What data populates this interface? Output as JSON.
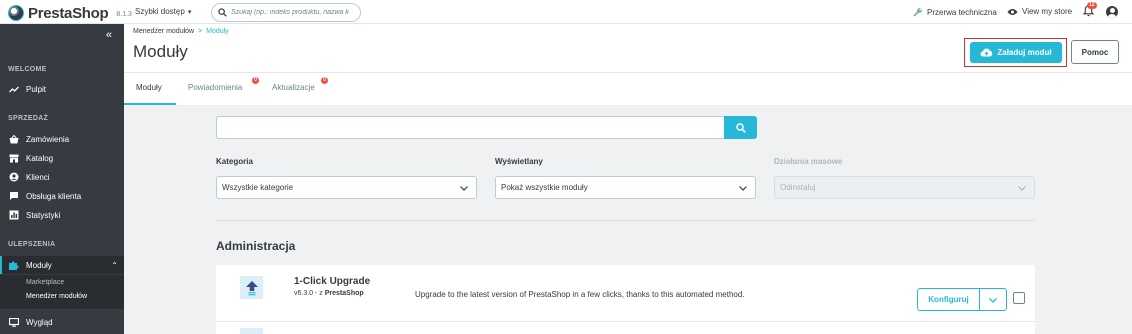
{
  "header": {
    "brand": "PrestaShop",
    "version": "8.1.3",
    "quick_access": "Szybki dostęp",
    "search_placeholder": "Szukaj (np.: indeks produktu, nazwa k",
    "maintenance": "Przerwa techniczna",
    "view_store": "View my store",
    "notifications_count": "12"
  },
  "sidebar": {
    "sections": {
      "welcome": "WELCOME",
      "sell": "SPRZEDAŻ",
      "improve": "ULEPSZENIA"
    },
    "items": [
      {
        "label": "Pulpit",
        "icon": "trending-up-icon"
      },
      {
        "label": "Zamówienia",
        "icon": "basket-icon"
      },
      {
        "label": "Katalog",
        "icon": "store-icon"
      },
      {
        "label": "Klienci",
        "icon": "account-circle-icon"
      },
      {
        "label": "Obsługa klienta",
        "icon": "chat-icon"
      },
      {
        "label": "Statystyki",
        "icon": "bar-chart-icon"
      },
      {
        "label": "Moduły",
        "icon": "puzzle-icon"
      },
      {
        "label": "Wygląd",
        "icon": "desktop-icon"
      }
    ],
    "sub_items": [
      "Marketplace",
      "Menedżer modułów"
    ]
  },
  "page": {
    "breadcrumb_parent": "Menedżer modułów",
    "breadcrumb_current": "Moduły",
    "title": "Moduły",
    "upload_button": "Załaduj moduł",
    "help_button": "Pomoc"
  },
  "tabs": [
    {
      "label": "Moduły",
      "badge": ""
    },
    {
      "label": "Powiadomienia",
      "badge": "0"
    },
    {
      "label": "Aktualizacje",
      "badge": "0"
    }
  ],
  "filters": {
    "category_label": "Kategoria",
    "category_value": "Wszystkie kategorie",
    "display_label": "Wyświetlany",
    "display_value": "Pokaż wszystkie moduły",
    "bulk_label": "Działania masowe",
    "bulk_value": "Odinstaluj"
  },
  "section_title": "Administracja",
  "modules": [
    {
      "name": "1-Click Upgrade",
      "version": "v6.3.0 - z",
      "author": "PrestaShop",
      "description": "Upgrade to the latest version of PrestaShop in a few clicks, thanks to this automated method.",
      "action": "Konfiguruj"
    }
  ],
  "colors": {
    "accent": "#25b9d7",
    "sidebar": "#363a41",
    "badge": "#f54c3e",
    "highlight_frame": "#d0342c"
  }
}
